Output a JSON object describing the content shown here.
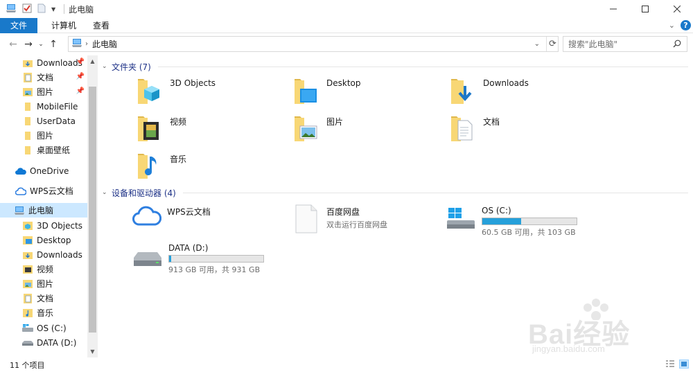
{
  "window": {
    "title": "此电脑"
  },
  "ribbon": {
    "tabs": [
      "文件",
      "计算机",
      "查看"
    ]
  },
  "address": {
    "path": "此电脑",
    "search_placeholder": "搜索\"此电脑\""
  },
  "nav": {
    "quick_access": [
      {
        "label": "Downloads",
        "icon": "downloads-folder-icon",
        "pinned": true
      },
      {
        "label": "文档",
        "icon": "documents-folder-icon",
        "pinned": true
      },
      {
        "label": "图片",
        "icon": "pictures-folder-icon",
        "pinned": true
      },
      {
        "label": "MobileFile",
        "icon": "folder-icon",
        "pinned": false
      },
      {
        "label": "UserData",
        "icon": "folder-icon",
        "pinned": false
      },
      {
        "label": "图片",
        "icon": "folder-icon",
        "pinned": false
      },
      {
        "label": "桌面壁纸",
        "icon": "folder-icon",
        "pinned": false
      }
    ],
    "onedrive": "OneDrive",
    "wps": "WPS云文档",
    "this_pc": "此电脑",
    "this_pc_children": [
      {
        "label": "3D Objects",
        "icon": "3d-objects-icon"
      },
      {
        "label": "Desktop",
        "icon": "desktop-folder-icon"
      },
      {
        "label": "Downloads",
        "icon": "downloads-folder-icon"
      },
      {
        "label": "视频",
        "icon": "videos-folder-icon"
      },
      {
        "label": "图片",
        "icon": "pictures-folder-icon"
      },
      {
        "label": "文档",
        "icon": "documents-folder-icon"
      },
      {
        "label": "音乐",
        "icon": "music-folder-icon"
      },
      {
        "label": "OS (C:)",
        "icon": "os-drive-icon"
      },
      {
        "label": "DATA (D:)",
        "icon": "drive-icon"
      }
    ]
  },
  "content": {
    "folders_header": "文件夹 (7)",
    "folders": [
      "3D Objects",
      "Desktop",
      "Downloads",
      "视频",
      "图片",
      "文档",
      "音乐"
    ],
    "devices_header": "设备和驱动器 (4)",
    "devices": {
      "wps": {
        "label": "WPS云文档"
      },
      "baidu": {
        "label": "百度网盘",
        "sub": "双击运行百度网盘"
      },
      "c_drive": {
        "label": "OS (C:)",
        "sub": "60.5 GB 可用，共 103 GB",
        "used_fraction": 0.41
      },
      "d_drive": {
        "label": "DATA (D:)",
        "sub": "913 GB 可用，共 931 GB",
        "used_fraction": 0.02
      }
    }
  },
  "status": {
    "count": "11 个项目"
  },
  "watermark": {
    "brand": "Bai经验",
    "url": "jingyan.baidu.com"
  },
  "colors": {
    "accent": "#1979ca",
    "drive_fill": "#26a0da",
    "selection": "#cce8ff",
    "folder": "#f8d775"
  }
}
